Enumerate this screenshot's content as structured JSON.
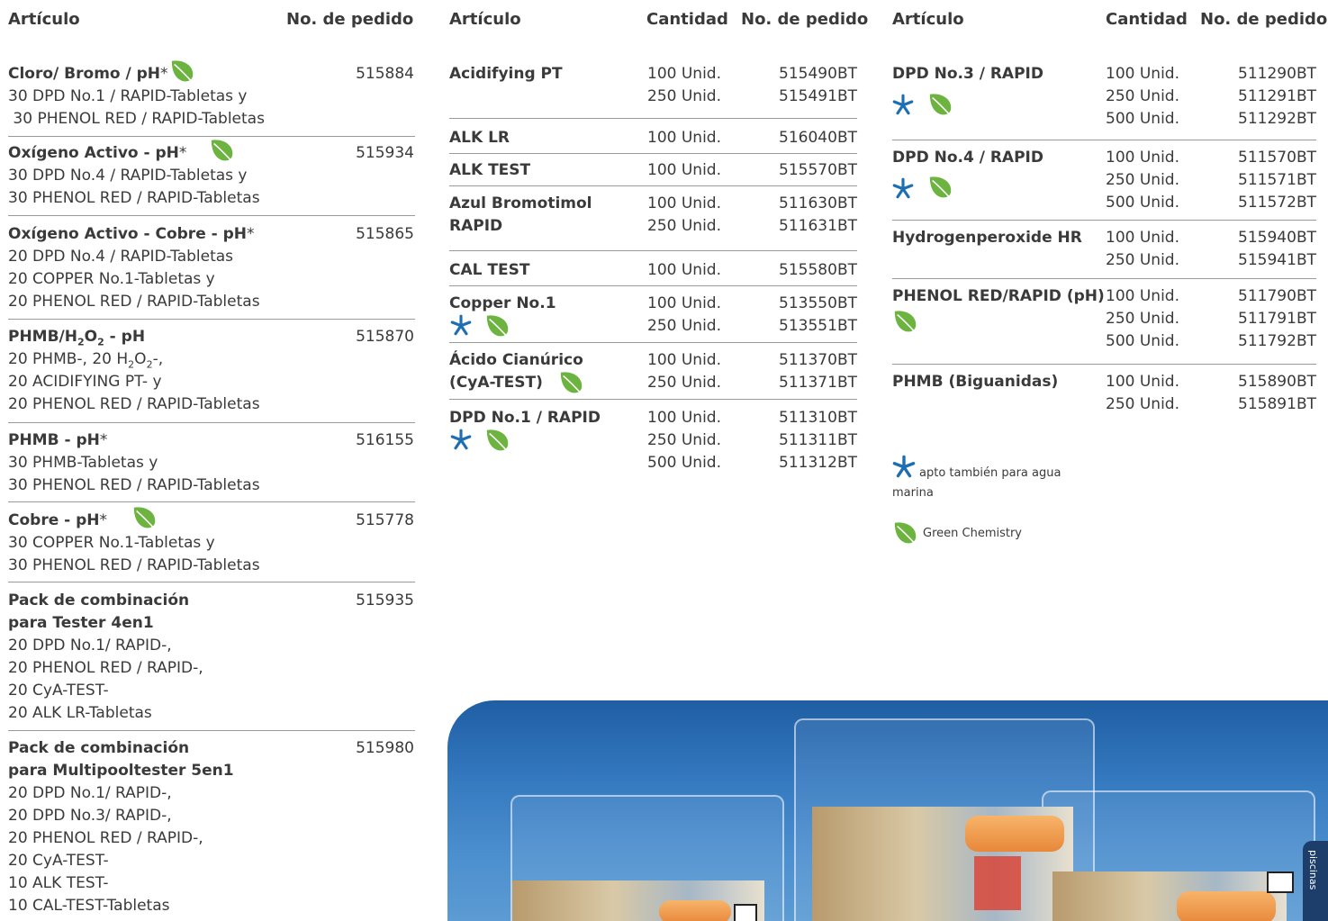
{
  "col1": {
    "header_articulo": "Artículo",
    "header_pedido": "No. de pedido",
    "items": [
      {
        "title": "Cloro/ Bromo / pH",
        "star": "*",
        "order": "515884",
        "lines": [
          "30 DPD No.1 / RAPID-Tabletas y",
          " 30 PHENOL RED / RAPID-Tabletas"
        ]
      },
      {
        "title": "Oxígeno Activo - pH",
        "star": "*",
        "order": "515934",
        "lines": [
          "30 DPD No.4 / RAPID-Tabletas y",
          "30 PHENOL RED / RAPID-Tabletas"
        ]
      },
      {
        "title": "Oxígeno Activo - Cobre - pH",
        "star": "*",
        "order": "515865",
        "lines": [
          "20 DPD No.4 / RAPID-Tabletas",
          "20 COPPER No.1-Tabletas y",
          "20 PHENOL RED / RAPID-Tabletas"
        ]
      },
      {
        "title_a": "PHMB/H",
        "title_sub1": "2",
        "title_b": "O",
        "title_sub2": "2",
        "title_c": " - pH",
        "order": "515870",
        "line1_a": "20 PHMB-, 20 H",
        "line1_sub1": "2",
        "line1_b": "O",
        "line1_sub2": "2",
        "line1_c": "-,",
        "lines": [
          "20 ACIDIFYING PT- y",
          "20 PHENOL RED / RAPID-Tabletas"
        ]
      },
      {
        "title": "PHMB - pH",
        "star": "*",
        "order": "516155",
        "lines": [
          "30 PHMB-Tabletas y",
          "30 PHENOL RED / RAPID-Tabletas"
        ]
      },
      {
        "title": "Cobre - pH",
        "star": "*",
        "order": "515778",
        "lines": [
          "30 COPPER No.1-Tabletas y",
          "30 PHENOL RED / RAPID-Tabletas"
        ]
      },
      {
        "title": "Pack de combinación",
        "title2": "para Tester 4en1",
        "order": "515935",
        "lines": [
          "20 DPD No.1/ RAPID-,",
          "20 PHENOL RED / RAPID-,",
          "20 CyA-TEST-",
          "20 ALK LR-Tabletas"
        ]
      },
      {
        "title": "Pack de combinación",
        "title2": "para Multipooltester 5en1",
        "order": "515980",
        "lines": [
          "20 DPD No.1/ RAPID-,",
          "20 DPD No.3/ RAPID-,",
          "20 PHENOL RED / RAPID-,",
          "20 CyA-TEST-",
          "10 ALK TEST-",
          "10 CAL-TEST-Tabletas"
        ]
      }
    ]
  },
  "col2": {
    "header_articulo": "Artículo",
    "header_cantidad": "Cantidad",
    "header_pedido": "No. de pedido",
    "items": [
      {
        "title": "Acidifying PT",
        "qty": [
          "100 Unid.",
          "250 Unid."
        ],
        "order": [
          "515490BT",
          "515491BT"
        ]
      },
      {
        "title": "ALK LR",
        "qty": [
          "100 Unid."
        ],
        "order": [
          "516040BT"
        ]
      },
      {
        "title": "ALK TEST",
        "qty": [
          "100 Unid."
        ],
        "order": [
          "515570BT"
        ]
      },
      {
        "title": "Azul Bromotimol",
        "title2": "RAPID",
        "qty": [
          "100 Unid.",
          "250 Unid."
        ],
        "order": [
          "511630BT",
          "511631BT"
        ]
      },
      {
        "title": "CAL TEST",
        "qty": [
          "100 Unid."
        ],
        "order": [
          "515580BT"
        ]
      },
      {
        "title": "Copper No.1",
        "qty": [
          "100 Unid.",
          "250 Unid."
        ],
        "order": [
          "513550BT",
          "513551BT"
        ]
      },
      {
        "title": "Ácido Cianúrico",
        "title2": "(CyA-TEST)",
        "qty": [
          "100 Unid.",
          "250 Unid."
        ],
        "order": [
          "511370BT",
          "511371BT"
        ]
      },
      {
        "title": "DPD No.1 / RAPID",
        "qty": [
          "100 Unid.",
          "250 Unid.",
          "500 Unid."
        ],
        "order": [
          "511310BT",
          "511311BT",
          "511312BT"
        ]
      }
    ]
  },
  "col3": {
    "header_articulo": "Artículo",
    "header_cantidad": "Cantidad",
    "header_pedido": "No. de pedido",
    "items": [
      {
        "title": "DPD No.3 / RAPID",
        "qty": [
          "100 Unid.",
          "250 Unid.",
          "500 Unid."
        ],
        "order": [
          "511290BT",
          "511291BT",
          "511292BT"
        ]
      },
      {
        "title": "DPD No.4 / RAPID",
        "qty": [
          "100 Unid.",
          "250 Unid.",
          "500 Unid."
        ],
        "order": [
          "511570BT",
          "511571BT",
          "511572BT"
        ]
      },
      {
        "title": "Hydrogenperoxide HR",
        "qty": [
          "100 Unid.",
          "250 Unid."
        ],
        "order": [
          "515940BT",
          "515941BT"
        ]
      },
      {
        "title": "PHENOL RED/RAPID (pH)",
        "qty": [
          "100 Unid.",
          "250 Unid.",
          "500 Unid."
        ],
        "order": [
          "511790BT",
          "511791BT",
          "511792BT"
        ]
      },
      {
        "title": "PHMB (Biguanidas)",
        "qty": [
          "100 Unid.",
          "250 Unid."
        ],
        "order": [
          "515890BT",
          "515891BT"
        ]
      }
    ],
    "legend_star": "apto también para agua",
    "legend_star2": "marina",
    "legend_leaf": "Green Chemistry"
  },
  "colors": {
    "leaf": "#6db33f",
    "star": "#1e6eb4",
    "rule": "#9a9a9a",
    "text": "#3a3a3a"
  },
  "icons": {
    "star": "star-icon",
    "leaf": "leaf-icon"
  },
  "photo": {
    "tab_text": "piscinas"
  }
}
